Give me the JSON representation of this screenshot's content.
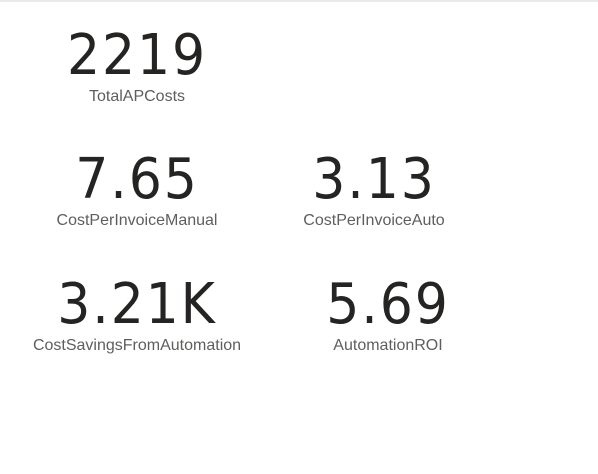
{
  "cards": [
    {
      "value": "2219",
      "label": "TotalAPCosts"
    },
    {
      "value": "7.65",
      "label": "CostPerInvoiceManual"
    },
    {
      "value": "3.13",
      "label": "CostPerInvoiceAuto"
    },
    {
      "value": "3.21K",
      "label": "CostSavingsFromAutomation"
    },
    {
      "value": "5.69",
      "label": "AutomationROI"
    }
  ],
  "colors": {
    "value_text": "#252423",
    "label_text": "#605e5c",
    "background": "#ffffff"
  }
}
